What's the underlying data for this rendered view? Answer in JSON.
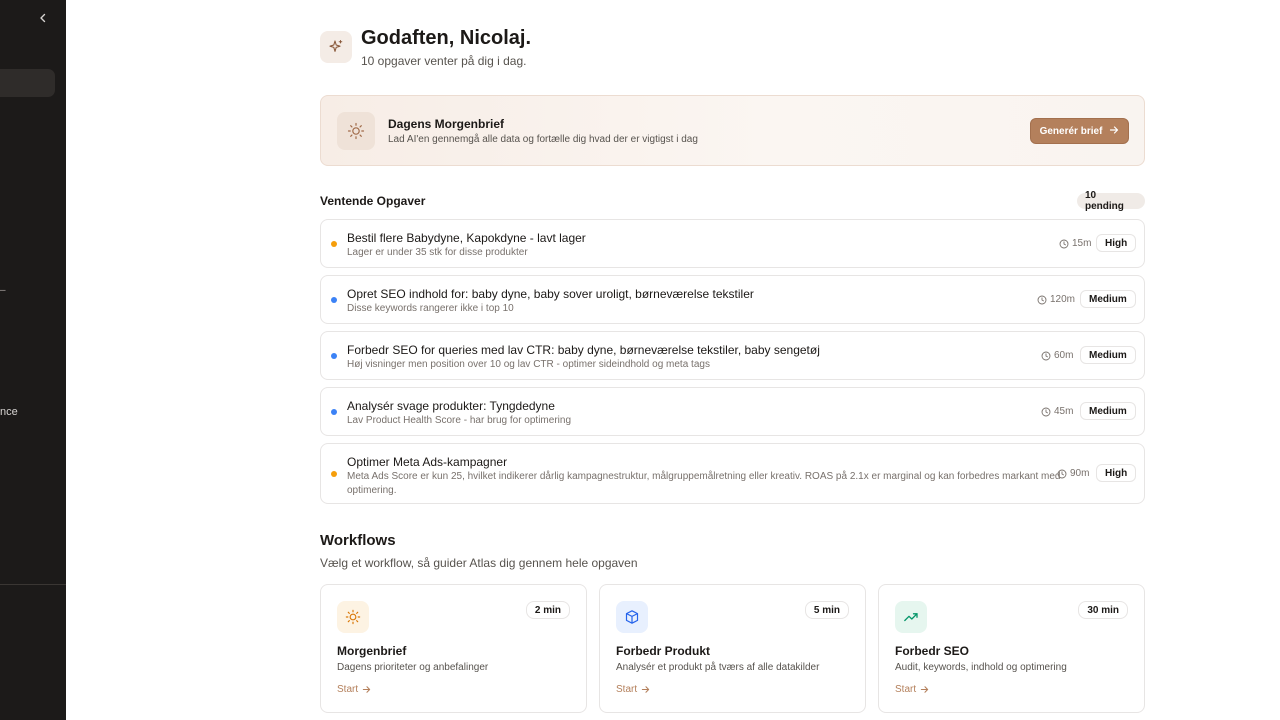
{
  "sidebar": {
    "collapse_icon": "chevron-left-icon",
    "cut_label": "nce",
    "cut_mark": "–"
  },
  "greeting": {
    "icon": "sparkles-icon",
    "title": "Godaften, Nicolaj.",
    "subtitle": "10 opgaver venter på dig i dag."
  },
  "brief": {
    "icon": "sun-icon",
    "title": "Dagens Morgenbrief",
    "subtitle": "Lad AI'en gennemgå alle data og fortælle dig hvad der er vigtigst i dag",
    "button_label": "Generér brief",
    "button_icon": "arrow-right-icon"
  },
  "tasks": {
    "title": "Ventende Opgaver",
    "badge": "10 pending",
    "colors": {
      "high": "#f59e0b",
      "medium": "#3b82f6"
    },
    "items": [
      {
        "title": "Bestil flere Babydyne, Kapokdyne - lavt lager",
        "subtitle": "Lager er under 35 stk for disse produkter",
        "time": "15m",
        "priority": "High"
      },
      {
        "title": "Opret SEO indhold for: baby dyne, baby sover uroligt, børneværelse tekstiler",
        "subtitle": "Disse keywords rangerer ikke i top 10",
        "time": "120m",
        "priority": "Medium"
      },
      {
        "title": "Forbedr SEO for queries med lav CTR: baby dyne, børneværelse tekstiler, baby sengetøj",
        "subtitle": "Høj visninger men position over 10 og lav CTR - optimer sideindhold og meta tags",
        "time": "60m",
        "priority": "Medium"
      },
      {
        "title": "Analysér svage produkter: Tyngdedyne",
        "subtitle": "Lav Product Health Score - har brug for optimering",
        "time": "45m",
        "priority": "Medium"
      },
      {
        "title": "Optimer Meta Ads-kampagner",
        "subtitle": "Meta Ads Score er kun 25, hvilket indikerer dårlig kampagnestruktur, målgruppemålretning eller kreativ. ROAS på 2.1x er marginal og kan forbedres markant med optimering.",
        "time": "90m",
        "priority": "High"
      }
    ]
  },
  "workflows": {
    "title": "Workflows",
    "subtitle": "Vælg et workflow, så guider Atlas dig gennem hele opgaven",
    "cards": [
      {
        "icon": "sun-icon",
        "accent": "#d97706",
        "time": "2 min",
        "title": "Morgenbrief",
        "subtitle": "Dagens prioriteter og anbefalinger",
        "start": "Start"
      },
      {
        "icon": "box-icon",
        "accent": "#2563eb",
        "time": "5 min",
        "title": "Forbedr Produkt",
        "subtitle": "Analysér et produkt på tværs af alle datakilder",
        "start": "Start"
      },
      {
        "icon": "trending-up-icon",
        "accent": "#059669",
        "time": "30 min",
        "title": "Forbedr SEO",
        "subtitle": "Audit, keywords, indhold og optimering",
        "start": "Start"
      }
    ]
  }
}
